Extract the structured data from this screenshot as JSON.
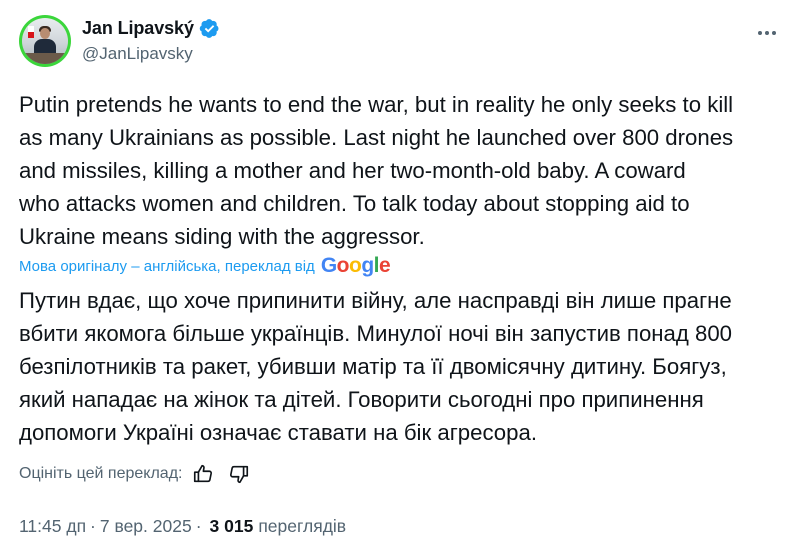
{
  "author": {
    "name": "Jan Lipavský",
    "handle": "@JanLipavsky",
    "verified": true,
    "verified_color": "#1d9bf0",
    "avatar_ring_color": "#3bd63b"
  },
  "tweet": {
    "original_text": "Putin pretends he wants to end the war, but in reality he only seeks to kill\nas many Ukrainians as possible. Last night he launched over 800 drones\nand missiles, killing a mother and her two-month-old baby. A coward\nwho attacks women and children. To talk today about stopping aid to\nUkraine means siding with the aggressor.",
    "translation_note": "Мова оригіналу – англійська, переклад від",
    "translation_provider": "Google",
    "translated_text": "Путин вдає, що хоче припинити війну, але насправді він лише прагне\nвбити якомога більше українців. Минулої ночі він запустив понад 800\nбезпілотників та ракет, убивши матір та її двомісячну дитину. Боягуз,\nякий нападає на жінок та дітей. Говорити сьогодні про припинення\nдопомоги Україні означає ставати на бік агресора.",
    "rate_label": "Оцініть цей переклад:",
    "time": "11:45 дп",
    "separator": "·",
    "date": "7 вер. 2025",
    "separator2": "·",
    "views_count": "3 015",
    "views_label": "переглядів"
  },
  "icons": {
    "more": "more-horizontal-icon",
    "thumb_up": "thumbs-up-icon",
    "thumb_down": "thumbs-down-icon",
    "verified": "verified-badge-icon"
  },
  "colors": {
    "text_primary": "#0f1419",
    "text_secondary": "#536471",
    "link": "#1d9bf0",
    "google_blue": "#4285F4",
    "google_red": "#EA4335",
    "google_yellow": "#FBBC05",
    "google_green": "#34A853"
  }
}
